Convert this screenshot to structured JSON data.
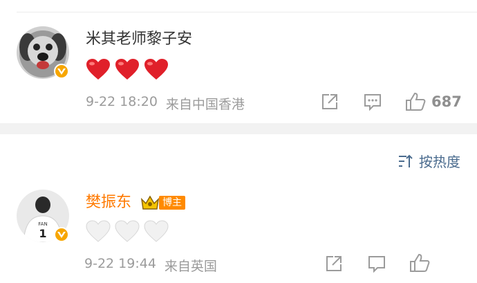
{
  "comments": [
    {
      "username": "米其老师黎子安",
      "username_color": "#333333",
      "content_emoji": [
        "red-heart",
        "red-heart",
        "red-heart"
      ],
      "date": "9-22 18:20",
      "source": "来自中国香港",
      "like_count": "687"
    },
    {
      "username": "樊振东",
      "username_color": "#ff7a00",
      "badge_label": "博主",
      "jersey_text": "1",
      "jersey_name": "FAN",
      "content_emoji": [
        "white-heart",
        "white-heart",
        "white-heart"
      ],
      "date": "9-22 19:44",
      "source": "来自英国"
    }
  ],
  "sort": {
    "label": "按热度"
  },
  "colors": {
    "accent_link": "#4a6b8e",
    "verify_badge": "#f7a600",
    "blogger_tag": "#ff8a00",
    "heart_red": "#e0202a",
    "heart_white": "#efefef"
  }
}
